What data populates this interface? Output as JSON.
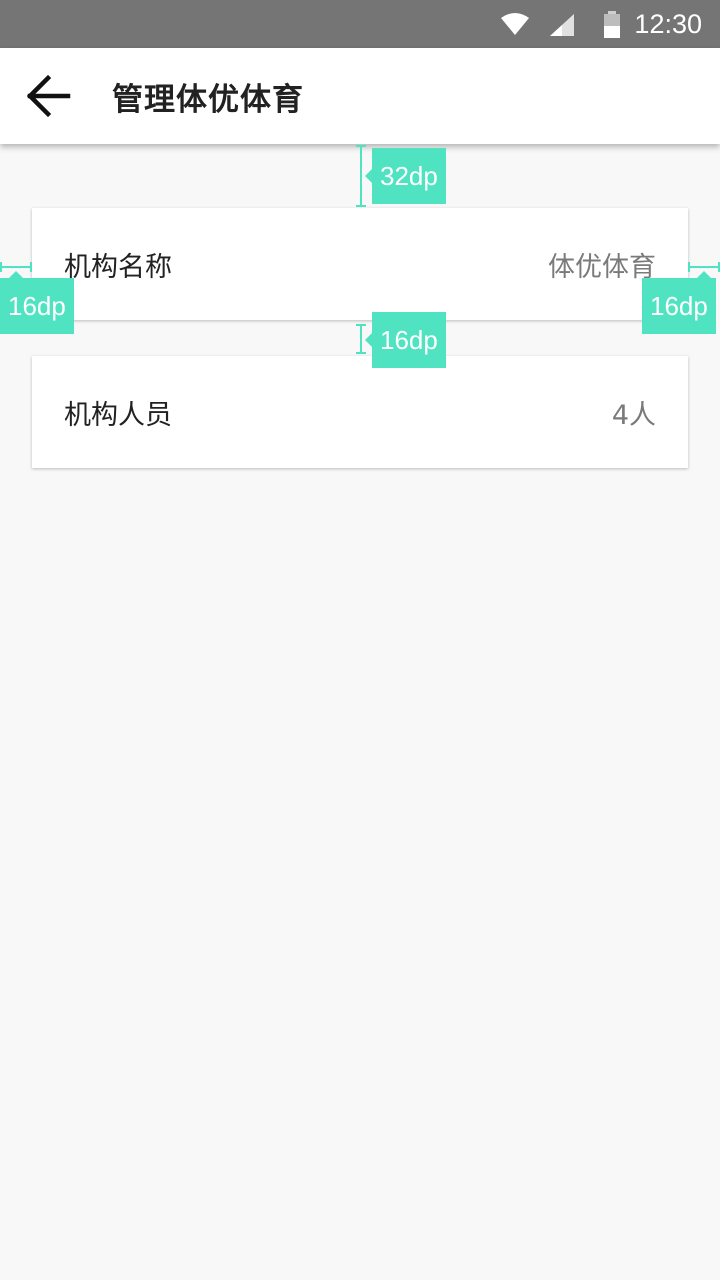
{
  "status_bar": {
    "time": "12:30",
    "icons": [
      "wifi-icon",
      "signal-icon",
      "battery-icon"
    ]
  },
  "app_bar": {
    "title": "管理体优体育",
    "back_icon": "arrow-back-icon"
  },
  "cards": [
    {
      "label": "机构名称",
      "value": "体优体育"
    },
    {
      "label": "机构人员",
      "value": "4人"
    }
  ],
  "annotations": {
    "top_spacing": "32dp",
    "left_margin": "16dp",
    "right_margin": "16dp",
    "card_gap": "16dp"
  },
  "colors": {
    "status_bar": "#757575",
    "app_bar": "#ffffff",
    "background": "#f8f8f8",
    "annotation": "#50e3c2",
    "label_text": "#222222",
    "value_text": "#7a7a7a"
  }
}
